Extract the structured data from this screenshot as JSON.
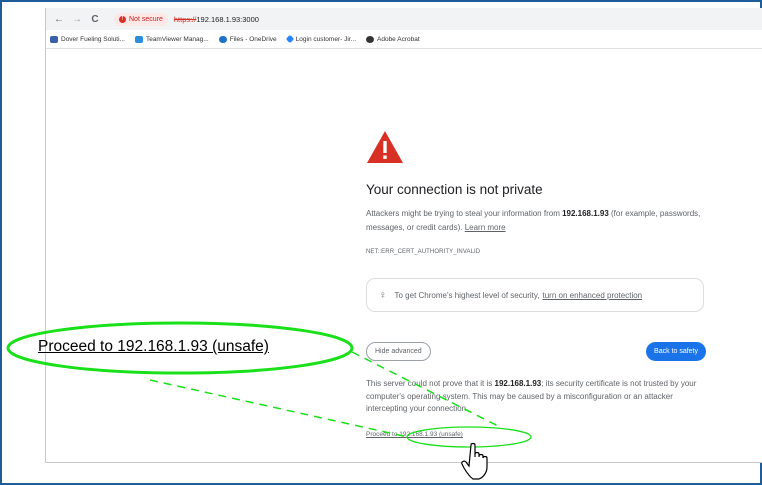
{
  "toolbar": {
    "back": "←",
    "forward": "→",
    "reload": "C",
    "security_chip": "Not secure",
    "url_scheme": "https://",
    "url_rest": "192.168.1.93:3000"
  },
  "bookmarks": [
    {
      "label": "Dover Fueling Soluti...",
      "icon": "dover-icon",
      "color": "#3b5fa8"
    },
    {
      "label": "TeamViewer Manag...",
      "icon": "teamviewer-icon",
      "color": "#2a8de0"
    },
    {
      "label": "Files - OneDrive",
      "icon": "onedrive-icon",
      "color": "#1e73c8"
    },
    {
      "label": "Login customer- Jir...",
      "icon": "jira-icon",
      "color": "#2684ff"
    },
    {
      "label": "Adobe Acrobat",
      "icon": "acrobat-icon",
      "color": "#333333"
    }
  ],
  "page": {
    "heading": "Your connection is not private",
    "para_a": "Attackers might be trying to steal your information from ",
    "para_host": "192.168.1.93",
    "para_b": " (for example, passwords, messages, or credit cards). ",
    "learn_more": "Learn more",
    "error_code": "NET::ERR_CERT_AUTHORITY_INVALID",
    "tip_text": "To get Chrome's highest level of security,",
    "tip_link": "turn on enhanced protection",
    "hide_advanced": "Hide advanced",
    "back_to_safety": "Back to safety",
    "detail_a": "This server could not prove that it is ",
    "detail_host": "192.168.1.93",
    "detail_b": "; its security certificate is not trusted by your computer's operating system. This may be caused by a misconfiguration or an attacker intercepting your connection.",
    "proceed_link": "Proceed to 192.168.1.93 (unsafe)"
  },
  "annotation": {
    "callout_text": "Proceed to 192.168.1.93 (unsafe)",
    "highlight_color": "#19e019"
  },
  "colors": {
    "warning_red": "#d93025",
    "primary_blue": "#1a73e8"
  }
}
